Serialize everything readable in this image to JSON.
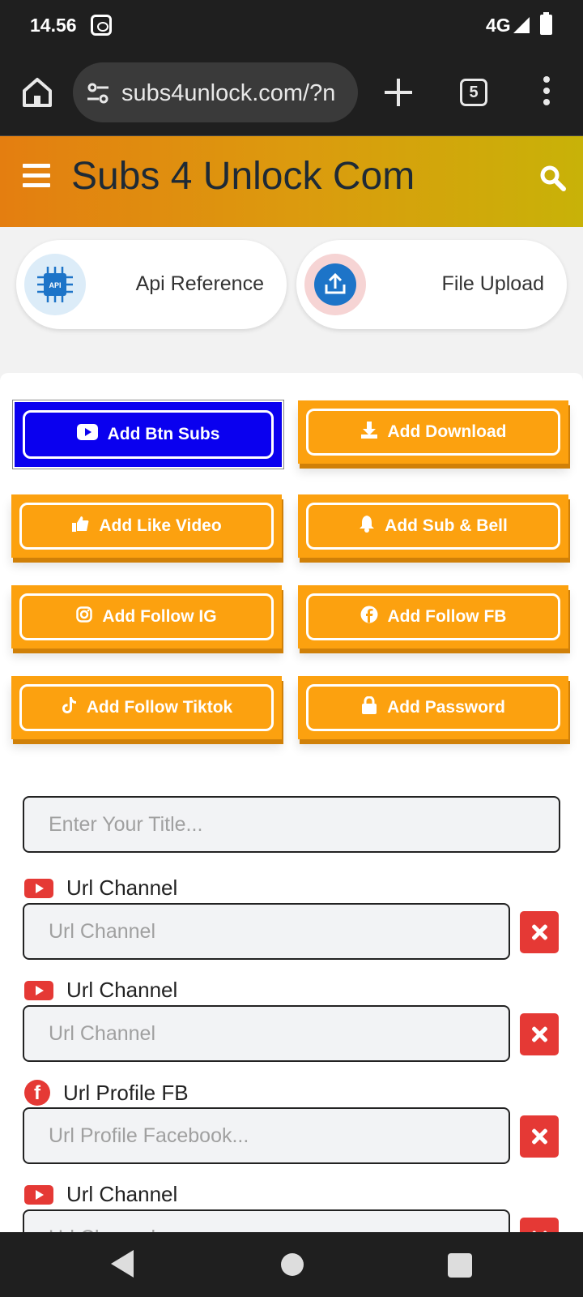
{
  "status_bar": {
    "time": "14.56",
    "network": "4G"
  },
  "browser": {
    "url": "subs4unlock.com/?n",
    "tab_count": "5"
  },
  "site": {
    "title": "Subs 4 Unlock Com"
  },
  "quick_links": {
    "api_label": "Api Reference",
    "api_icon_text": "API",
    "upload_label": "File Upload"
  },
  "actions": {
    "btn_subs": "Add Btn Subs",
    "download": "Add Download",
    "like_video": "Add Like Video",
    "sub_bell": "Add Sub & Bell",
    "follow_ig": "Add Follow IG",
    "follow_fb": "Add Follow FB",
    "follow_tiktok": "Add Follow Tiktok",
    "password": "Add Password"
  },
  "form": {
    "title_placeholder": "Enter Your Title...",
    "fields": [
      {
        "label": "Url Channel",
        "placeholder": "Url Channel"
      },
      {
        "label": "Url Channel",
        "placeholder": "Url Channel"
      },
      {
        "label": "Url Profile FB",
        "placeholder": "Url Profile Facebook..."
      },
      {
        "label": "Url Channel",
        "placeholder": "Url Channel"
      }
    ]
  },
  "colors": {
    "header_gradient_start": "#e47e10",
    "header_gradient_end": "#c8b208",
    "action_orange": "#fca10f",
    "action_active_blue": "#0a00ef",
    "delete_red": "#e53935"
  },
  "icons": {
    "home": "home-icon",
    "site_settings": "tune-icon",
    "new_tab": "plus-icon",
    "tabs": "tab-switcher-icon",
    "more": "more-vert-icon",
    "menu": "hamburger-icon",
    "search": "search-icon",
    "api": "chip-icon",
    "upload": "upload-icon",
    "youtube": "youtube-icon",
    "download": "download-icon",
    "like": "thumbs-up-icon",
    "bell": "bell-icon",
    "instagram": "instagram-icon",
    "facebook": "facebook-icon",
    "tiktok": "tiktok-icon",
    "lock": "lock-icon",
    "delete": "close-icon"
  }
}
